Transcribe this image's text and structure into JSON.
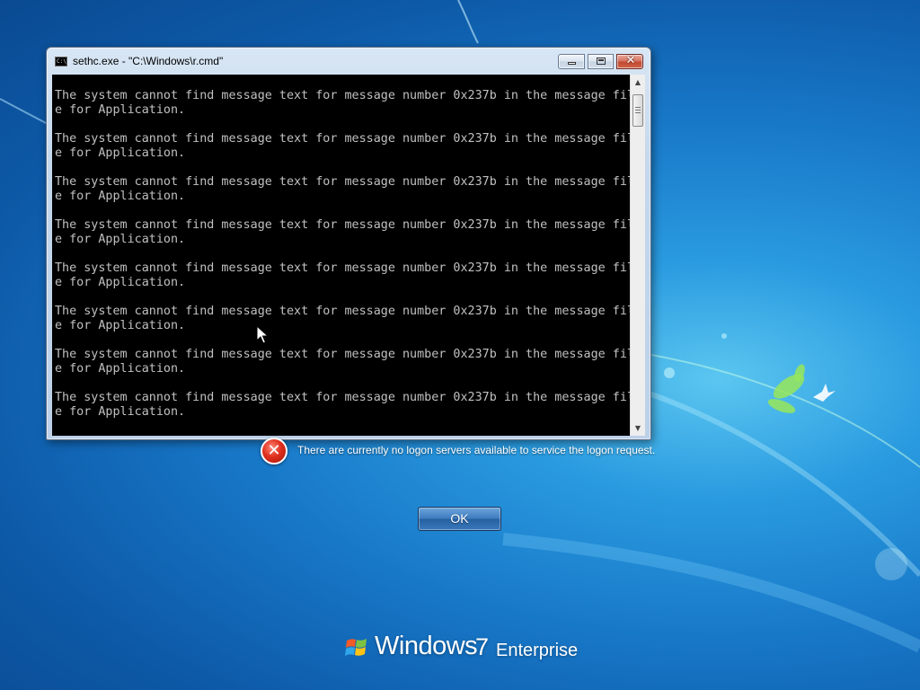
{
  "console_window": {
    "title": "sethc.exe - \"C:\\Windows\\r.cmd\"",
    "app_icon_glyph": "C:\\",
    "close_glyph": "✕",
    "output_lines": [
      "The system cannot find message text for message number 0x237b in the message fil",
      "e for Application.",
      "",
      "The system cannot find message text for message number 0x237b in the message fil",
      "e for Application.",
      "",
      "The system cannot find message text for message number 0x237b in the message fil",
      "e for Application.",
      "",
      "The system cannot find message text for message number 0x237b in the message fil",
      "e for Application.",
      "",
      "The system cannot find message text for message number 0x237b in the message fil",
      "e for Application.",
      "",
      "The system cannot find message text for message number 0x237b in the message fil",
      "e for Application.",
      "",
      "The system cannot find message text for message number 0x237b in the message fil",
      "e for Application.",
      "",
      "The system cannot find message text for message number 0x237b in the message fil",
      "e for Application."
    ],
    "scroll_up_glyph": "▲",
    "scroll_down_glyph": "▼"
  },
  "logon": {
    "error_icon_glyph": "✕",
    "error_message": "There are currently no logon servers available to service the logon request.",
    "ok_label": "OK"
  },
  "branding": {
    "product": "Windows",
    "version": "7",
    "edition": "Enterprise"
  },
  "icons": {
    "app": "console-icon",
    "error": "error-icon",
    "logo": "windows-flag-icon",
    "cursor": "mouse-pointer-icon"
  },
  "colors": {
    "console_background": "#000000",
    "console_text": "#c0c0c0",
    "close_button": "#c24a32",
    "error_icon": "#e0301e",
    "ok_button": "#3e7cc0",
    "desktop_background": "#1878c8"
  }
}
